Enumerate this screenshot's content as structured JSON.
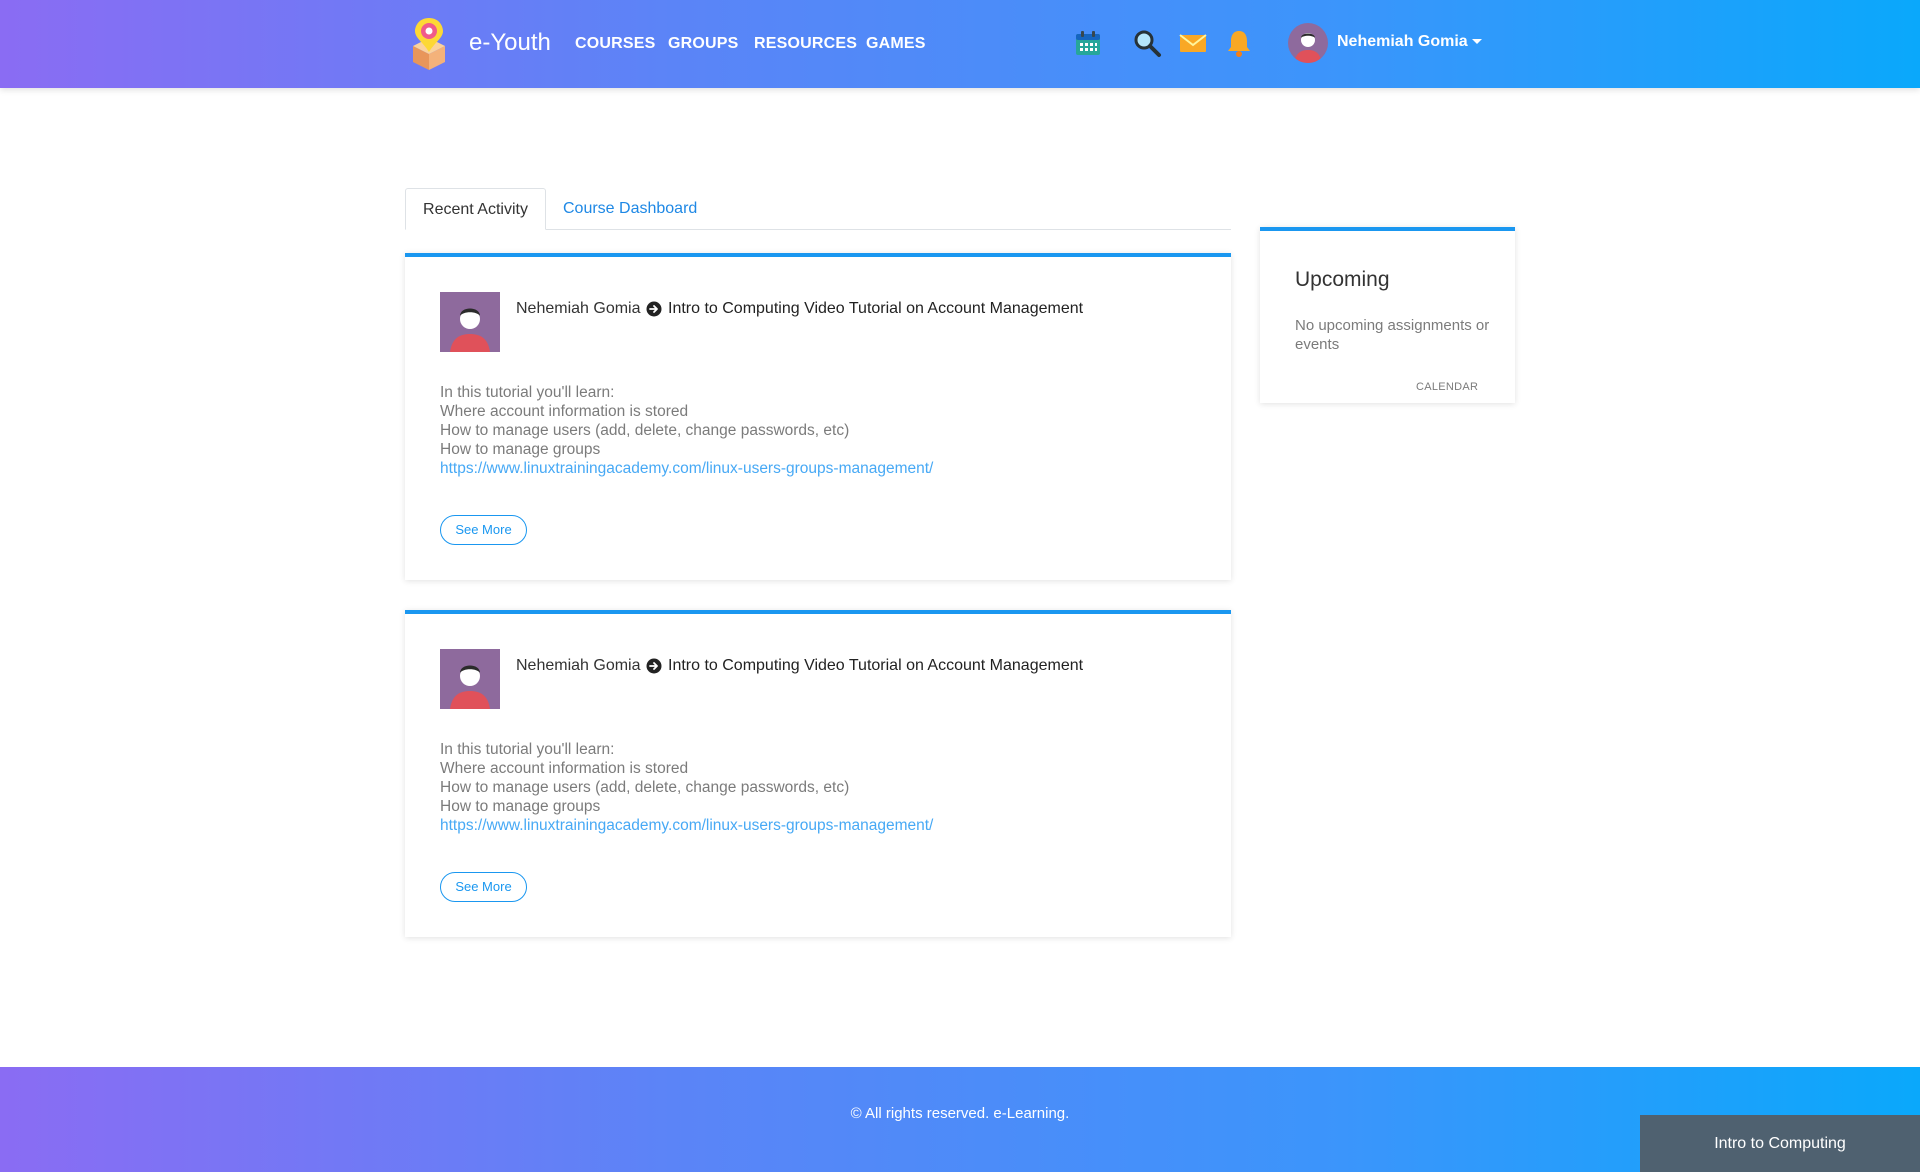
{
  "header": {
    "brand": "e-Youth",
    "nav": [
      "COURSES",
      "GROUPS",
      "RESOURCES",
      "GAMES"
    ],
    "icons": [
      "calendar-icon",
      "search-icon",
      "mail-icon",
      "bell-icon"
    ],
    "user_name": "Nehemiah Gomia"
  },
  "tabs": {
    "recent_activity": "Recent Activity",
    "course_dashboard": "Course Dashboard"
  },
  "activities": [
    {
      "author": "Nehemiah Gomia",
      "title": "Intro to Computing Video Tutorial on Account Management",
      "lines": [
        "In this tutorial you'll learn:",
        "Where account information is stored",
        "How to manage users (add, delete, change passwords, etc)",
        "How to manage groups"
      ],
      "link": "https://www.linuxtrainingacademy.com/linux-users-groups-management/",
      "button": "See More"
    },
    {
      "author": "Nehemiah Gomia",
      "title": "Intro to Computing Video Tutorial on Account Management",
      "lines": [
        "In this tutorial you'll learn:",
        "Where account information is stored",
        "How to manage users (add, delete, change passwords, etc)",
        "How to manage groups"
      ],
      "link": "https://www.linuxtrainingacademy.com/linux-users-groups-management/",
      "button": "See More"
    }
  ],
  "upcoming": {
    "title": "Upcoming",
    "empty_text": "No upcoming assignments or events",
    "calendar_link": "CALENDAR"
  },
  "footer": {
    "text": "© All rights reserved. e-Learning.",
    "course_chip": "Intro to Computing"
  },
  "colors": {
    "accent": "#1a97f0",
    "link": "#47a9f5",
    "gradient_start": "#8a6cf3",
    "gradient_end": "#0aa8fb",
    "chip": "#4f6170"
  }
}
